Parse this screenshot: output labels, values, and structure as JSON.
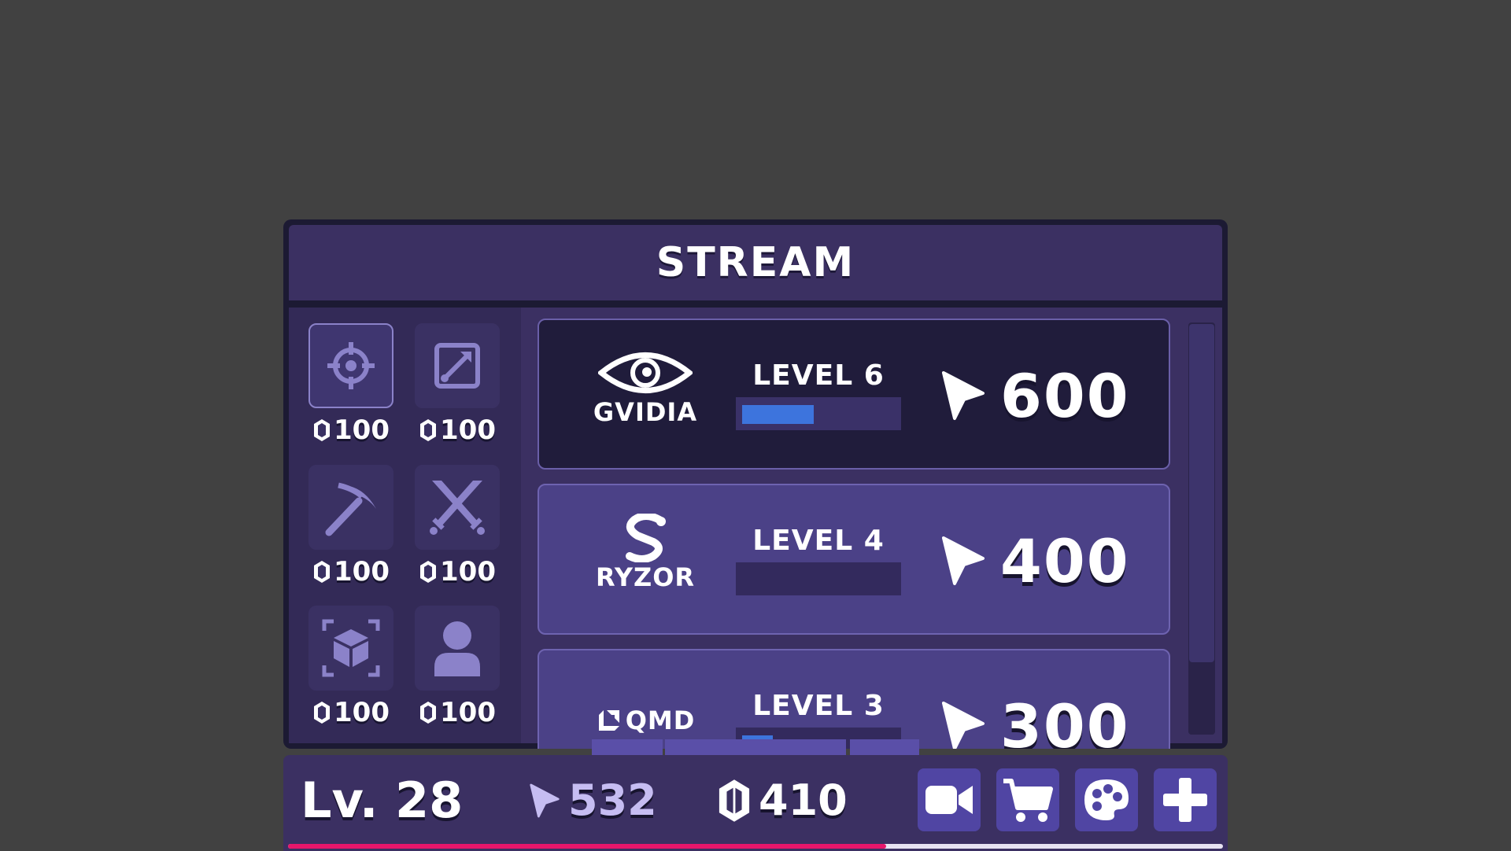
{
  "window": {
    "title": "STREAM"
  },
  "upgrades": [
    {
      "icon": "crosshair-icon",
      "cost": "100",
      "selected": true
    },
    {
      "icon": "resize-icon",
      "cost": "100",
      "selected": false
    },
    {
      "icon": "pickaxe-icon",
      "cost": "100",
      "selected": false
    },
    {
      "icon": "crossed-swords-icon",
      "cost": "100",
      "selected": false
    },
    {
      "icon": "cube-icon",
      "cost": "100",
      "selected": false
    },
    {
      "icon": "user-icon",
      "cost": "100",
      "selected": false
    }
  ],
  "sponsors": [
    {
      "name": "GVIDIA",
      "level": "LEVEL 6",
      "progress": 0.47,
      "earnings": "600",
      "active": true
    },
    {
      "name": "RYZOR",
      "level": "LEVEL 4",
      "progress": 0.0,
      "earnings": "400",
      "active": false
    },
    {
      "name": "QMD",
      "level": "LEVEL 3",
      "progress": 0.2,
      "earnings": "300",
      "active": false
    }
  ],
  "player": {
    "level": "Lv. 28",
    "clicks": "532",
    "gems": "410",
    "xp_progress": 0.64
  },
  "toolbar": {
    "buttons": [
      "video-camera-icon",
      "cart-icon",
      "palette-icon",
      "plus-icon"
    ]
  },
  "colors": {
    "accent": "#5045a3",
    "xp_bar": "#e6166b",
    "progress": "#3d74dd",
    "clicks_text": "#c6bdf2"
  }
}
